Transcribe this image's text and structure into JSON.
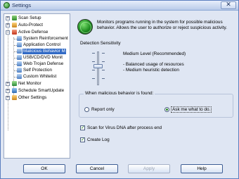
{
  "window": {
    "title": "Settings"
  },
  "tree": {
    "items": [
      {
        "label": "Scan Setup",
        "expander": "+"
      },
      {
        "label": "Auto-Protect",
        "expander": "+"
      },
      {
        "label": "Active Defense",
        "expander": "-"
      },
      {
        "label": "System Reinforcement"
      },
      {
        "label": "Application Control"
      },
      {
        "label": "Malicious Behavior M"
      },
      {
        "label": "USB/CD/DVD Monit"
      },
      {
        "label": "Web Trojan Defense"
      },
      {
        "label": "Self Protection"
      },
      {
        "label": "Custom Whitelist"
      },
      {
        "label": "Net Monitor",
        "expander": "+"
      },
      {
        "label": "Schedule SmartUpdate",
        "expander": "+"
      },
      {
        "label": "Other Settings",
        "expander": "+"
      }
    ]
  },
  "panel": {
    "description": "Monitors programs running in the system for possible malicious behavior.  Allows the user to authorize or reject suspicious activity.",
    "sensitivity_label": "Detection Sensitivity",
    "sensitivity_level": 0.5,
    "level_title": "Medium Level (Recommended)",
    "level_desc1": "- Balanced usage of resources",
    "level_desc2": "- Medium heuristic detection",
    "behavior_group": "When malicious behavior is found:",
    "radio_report": "Report only",
    "radio_ask": "Ask me what to do.",
    "check_dna": "Scan for Virus DNA after process end",
    "check_log": "Create Log"
  },
  "buttons": {
    "ok": "OK",
    "cancel": "Cancel",
    "apply": "Apply",
    "help": "Help"
  }
}
